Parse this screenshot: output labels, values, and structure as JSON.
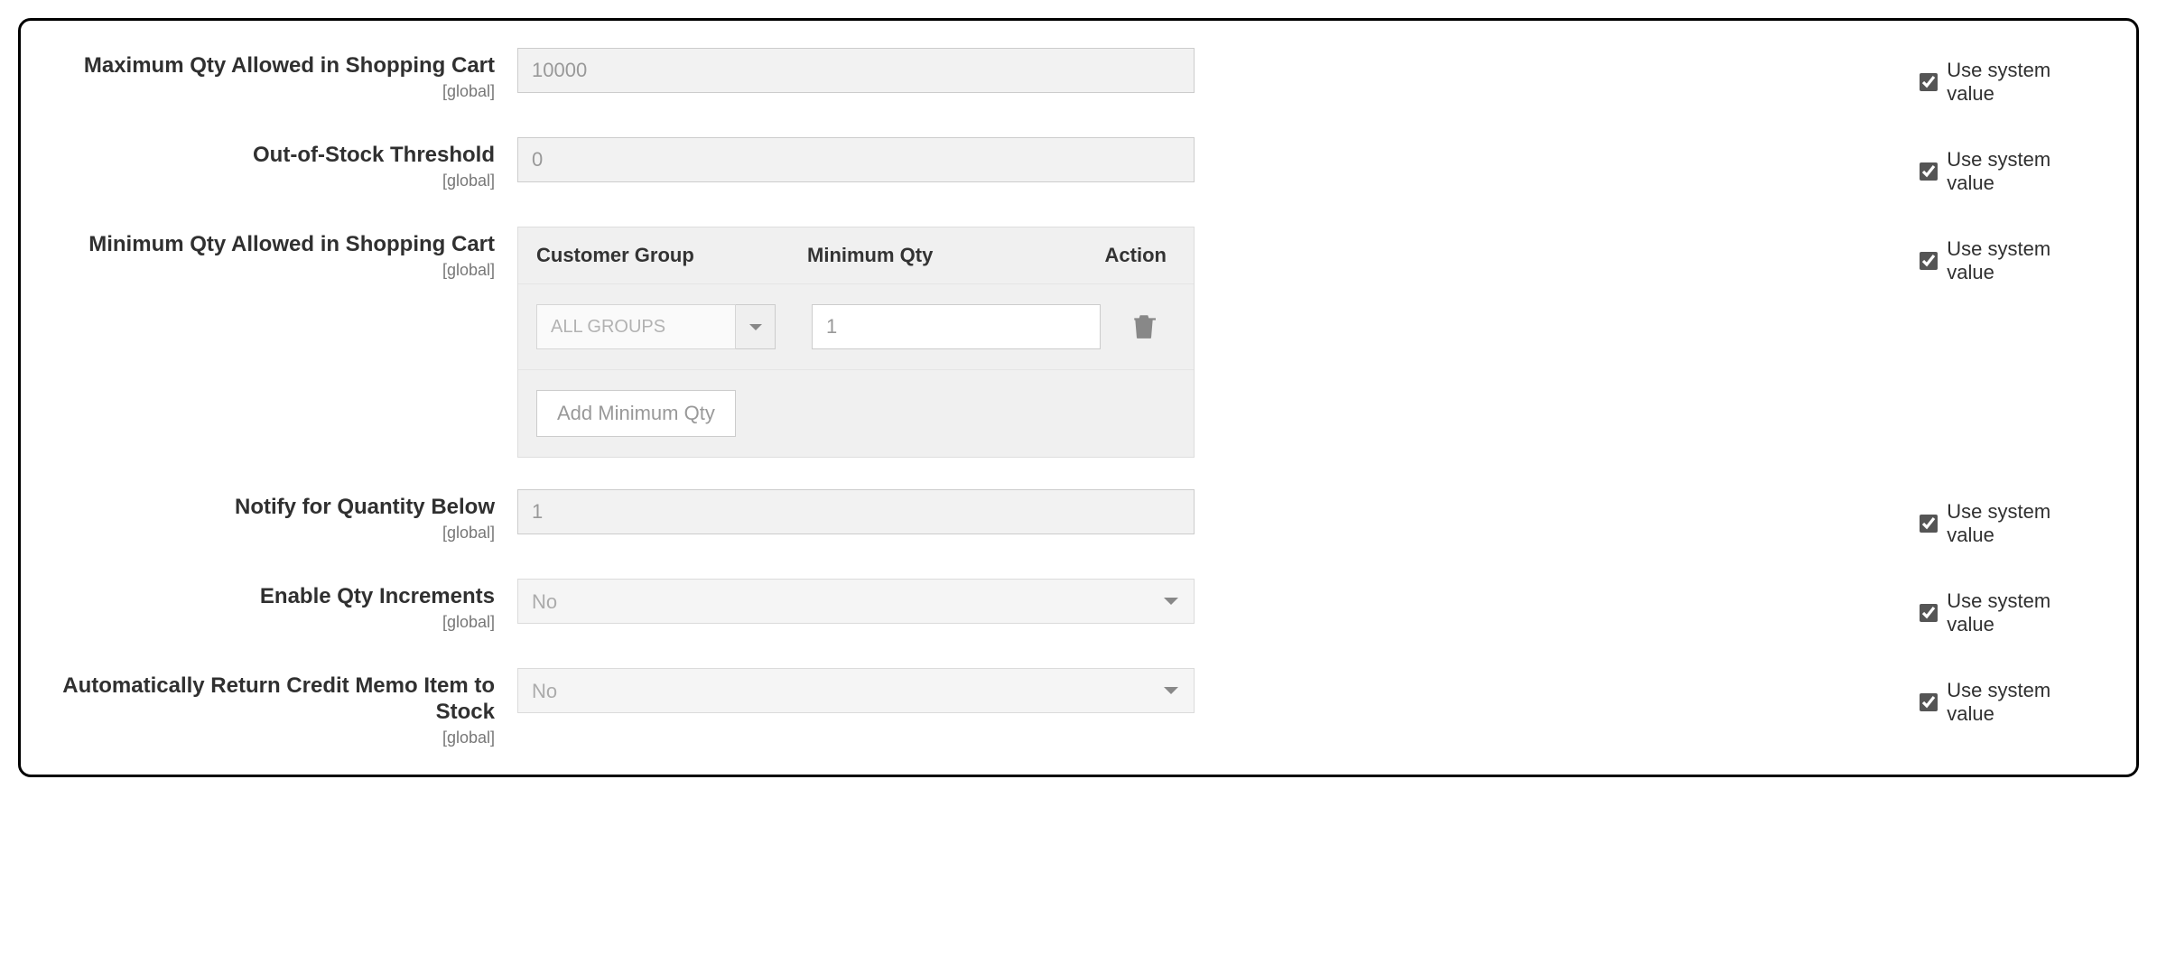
{
  "scope_text": "[global]",
  "use_system_value_label": "Use system value",
  "fields": {
    "max_qty": {
      "label": "Maximum Qty Allowed in Shopping Cart",
      "value": "10000",
      "system": true
    },
    "out_of_stock": {
      "label": "Out-of-Stock Threshold",
      "value": "0",
      "system": true
    },
    "min_qty": {
      "label": "Minimum Qty Allowed in Shopping Cart",
      "system": true,
      "table": {
        "headers": {
          "group": "Customer Group",
          "min": "Minimum Qty",
          "action": "Action"
        },
        "rows": [
          {
            "group": "ALL GROUPS",
            "min": "1"
          }
        ],
        "add_label": "Add Minimum Qty"
      }
    },
    "notify_below": {
      "label": "Notify for Quantity Below",
      "value": "1",
      "system": true
    },
    "qty_increments": {
      "label": "Enable Qty Increments",
      "value": "No",
      "system": true
    },
    "auto_return": {
      "label": "Automatically Return Credit Memo Item to Stock",
      "value": "No",
      "system": true
    }
  }
}
